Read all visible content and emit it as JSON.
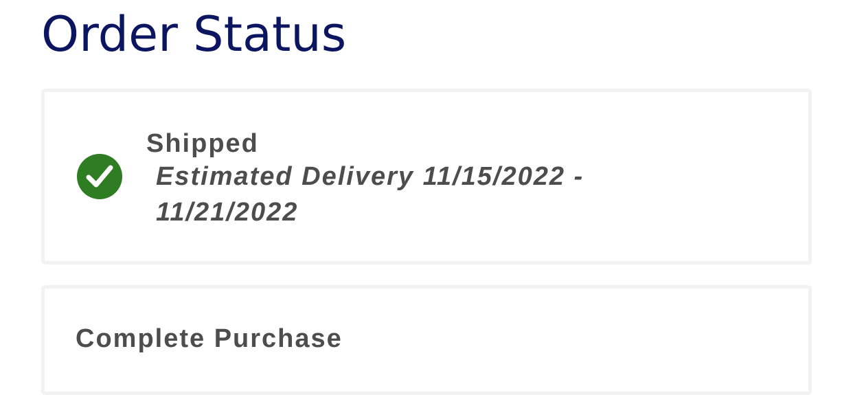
{
  "page": {
    "title": "Order Status"
  },
  "shipment": {
    "status": "Shipped",
    "status_icon": "check-circle-icon",
    "delivery_estimate": "Estimated Delivery 11/15/2022 - 11/21/2022"
  },
  "action": {
    "label": "Complete Purchase"
  },
  "colors": {
    "title": "#0b1560",
    "text": "#4d4d4d",
    "success": "#2e7d22",
    "card_border": "#f2f2f2"
  }
}
